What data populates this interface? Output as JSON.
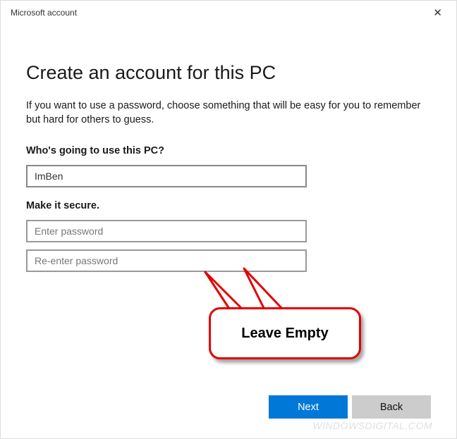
{
  "titlebar": {
    "title": "Microsoft account"
  },
  "page": {
    "heading": "Create an account for this PC",
    "description": "If you want to use a password, choose something that will be easy for you to remember but hard for others to guess."
  },
  "form": {
    "username_label": "Who's going to use this PC?",
    "username_value": "ImBen",
    "password_label": "Make it secure.",
    "password_placeholder": "Enter password",
    "password_confirm_placeholder": "Re-enter password"
  },
  "buttons": {
    "next": "Next",
    "back": "Back"
  },
  "annotation": {
    "callout_text": "Leave Empty"
  },
  "watermark": "WindowsDigital.com"
}
